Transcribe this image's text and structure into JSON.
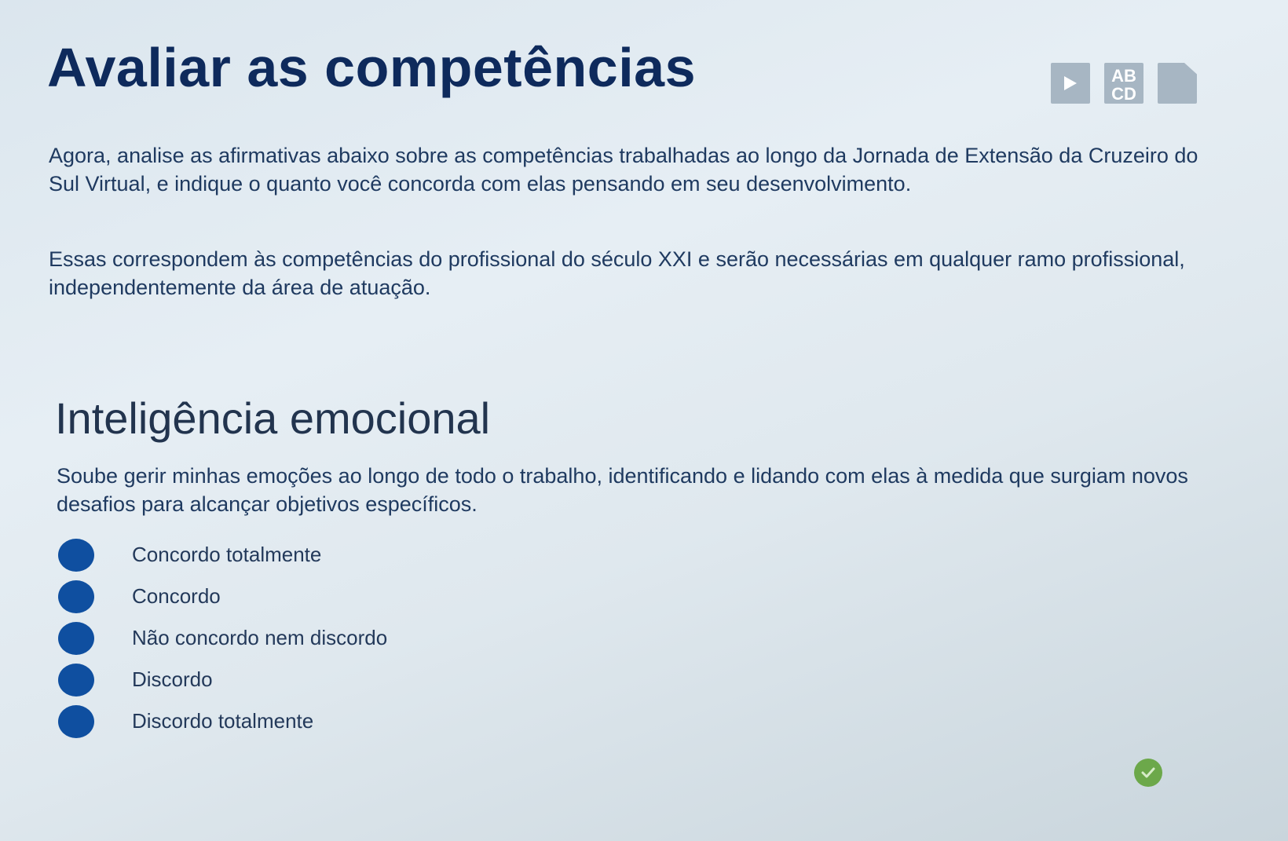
{
  "header": {
    "title": "Avaliar as competências",
    "toolbar": {
      "play_icon": "play-icon",
      "abcd_icon": {
        "line1": "AB",
        "line2": "CD"
      },
      "document_icon": "document-icon"
    }
  },
  "intro": {
    "paragraph1": "Agora, analise as afirmativas abaixo sobre as competências trabalhadas ao longo da Jornada de Extensão da Cruzeiro do Sul Virtual, e indique o quanto você concorda com elas pensando em seu desenvolvimento.",
    "paragraph2": "Essas correspondem às competências do profissional do século XXI e serão necessárias em qualquer ramo profissional, independentemente da área de atuação."
  },
  "section": {
    "title": "Inteligência emocional",
    "question": "Soube gerir minhas emoções ao longo de todo o trabalho, identificando e lidando com elas à medida que surgiam novos desafios para alcançar objetivos específicos.",
    "options": [
      {
        "label": "Concordo totalmente"
      },
      {
        "label": "Concordo"
      },
      {
        "label": "Não concordo nem discordo"
      },
      {
        "label": "Discordo"
      },
      {
        "label": "Discordo totalmente"
      }
    ]
  },
  "status": {
    "icon": "check-icon",
    "color": "#6ca84a"
  },
  "colors": {
    "title": "#0e2a5c",
    "radio": "#0f4fa0",
    "toolbar": "#a7b6c3"
  }
}
